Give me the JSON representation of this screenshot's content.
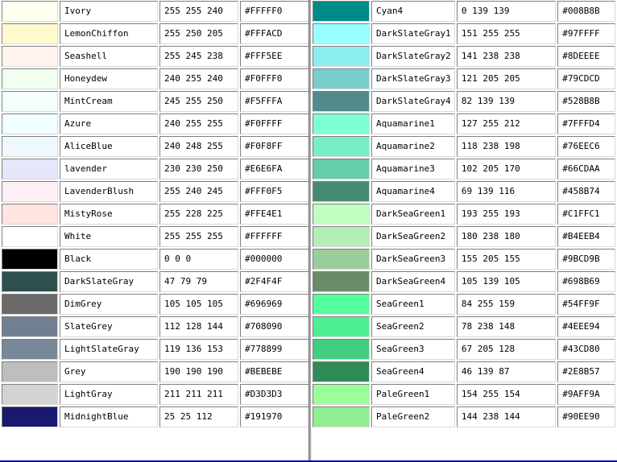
{
  "left_column": [
    {
      "name": "Ivory",
      "rgb": "255 255 240",
      "hex": "#FFFFF0",
      "color": "#FFFFF0"
    },
    {
      "name": "LemonChiffon",
      "rgb": "255 250 205",
      "hex": "#FFFACD",
      "color": "#FFFACD"
    },
    {
      "name": "Seashell",
      "rgb": "255 245 238",
      "hex": "#FFF5EE",
      "color": "#FFF5EE"
    },
    {
      "name": "Honeydew",
      "rgb": "240 255 240",
      "hex": "#F0FFF0",
      "color": "#F0FFF0"
    },
    {
      "name": "MintCream",
      "rgb": "245 255 250",
      "hex": "#F5FFFA",
      "color": "#F5FFFA"
    },
    {
      "name": "Azure",
      "rgb": "240 255 255",
      "hex": "#F0FFFF",
      "color": "#F0FFFF"
    },
    {
      "name": "AliceBlue",
      "rgb": "240 248 255",
      "hex": "#F0F8FF",
      "color": "#F0F8FF"
    },
    {
      "name": "lavender",
      "rgb": "230 230 250",
      "hex": "#E6E6FA",
      "color": "#E6E6FA"
    },
    {
      "name": "LavenderBlush",
      "rgb": "255 240 245",
      "hex": "#FFF0F5",
      "color": "#FFF0F5"
    },
    {
      "name": "MistyRose",
      "rgb": "255 228 225",
      "hex": "#FFE4E1",
      "color": "#FFE4E1"
    },
    {
      "name": "White",
      "rgb": "255 255 255",
      "hex": "#FFFFFF",
      "color": "#FFFFFF"
    },
    {
      "name": "Black",
      "rgb": "0 0 0",
      "hex": "#000000",
      "color": "#000000"
    },
    {
      "name": "DarkSlateGray",
      "rgb": "47 79 79",
      "hex": "#2F4F4F",
      "color": "#2F4F4F"
    },
    {
      "name": "DimGrey",
      "rgb": "105 105 105",
      "hex": "#696969",
      "color": "#696969"
    },
    {
      "name": "SlateGrey",
      "rgb": "112 128 144",
      "hex": "#708090",
      "color": "#708090"
    },
    {
      "name": "LightSlateGray",
      "rgb": "119 136 153",
      "hex": "#778899",
      "color": "#778899"
    },
    {
      "name": "Grey",
      "rgb": "190 190 190",
      "hex": "#BEBEBE",
      "color": "#BEBEBE"
    },
    {
      "name": "LightGray",
      "rgb": "211 211 211",
      "hex": "#D3D3D3",
      "color": "#D3D3D3"
    },
    {
      "name": "MidnightBlue",
      "rgb": "25 25 112",
      "hex": "#191970",
      "color": "#191970"
    }
  ],
  "right_column": [
    {
      "name": "Cyan4",
      "rgb": "0 139 139",
      "hex": "#008B8B",
      "color": "#008B8B"
    },
    {
      "name": "DarkSlateGray1",
      "rgb": "151 255 255",
      "hex": "#97FFFF",
      "color": "#97FFFF"
    },
    {
      "name": "DarkSlateGray2",
      "rgb": "141 238 238",
      "hex": "#8DEEEE",
      "color": "#8DEEEE"
    },
    {
      "name": "DarkSlateGray3",
      "rgb": "121 205 205",
      "hex": "#79CDCD",
      "color": "#79CDCD"
    },
    {
      "name": "DarkSlateGray4",
      "rgb": "82 139 139",
      "hex": "#528B8B",
      "color": "#528B8B"
    },
    {
      "name": "Aquamarine1",
      "rgb": "127 255 212",
      "hex": "#7FFFD4",
      "color": "#7FFFD4"
    },
    {
      "name": "Aquamarine2",
      "rgb": "118 238 198",
      "hex": "#76EEC6",
      "color": "#76EEC6"
    },
    {
      "name": "Aquamarine3",
      "rgb": "102 205 170",
      "hex": "#66CDAA",
      "color": "#66CDAA"
    },
    {
      "name": "Aquamarine4",
      "rgb": "69 139 116",
      "hex": "#458B74",
      "color": "#458B74"
    },
    {
      "name": "DarkSeaGreen1",
      "rgb": "193 255 193",
      "hex": "#C1FFC1",
      "color": "#C1FFC1"
    },
    {
      "name": "DarkSeaGreen2",
      "rgb": "180 238 180",
      "hex": "#B4EEB4",
      "color": "#B4EEB4"
    },
    {
      "name": "DarkSeaGreen3",
      "rgb": "155 205 155",
      "hex": "#9BCD9B",
      "color": "#9BCD9B"
    },
    {
      "name": "DarkSeaGreen4",
      "rgb": "105 139 105",
      "hex": "#698B69",
      "color": "#698B69"
    },
    {
      "name": "SeaGreen1",
      "rgb": "84 255 159",
      "hex": "#54FF9F",
      "color": "#54FF9F"
    },
    {
      "name": "SeaGreen2",
      "rgb": "78 238 148",
      "hex": "#4EEE94",
      "color": "#4EEE94"
    },
    {
      "name": "SeaGreen3",
      "rgb": "67 205 128",
      "hex": "#43CD80",
      "color": "#43CD80"
    },
    {
      "name": "SeaGreen4",
      "rgb": "46 139 87",
      "hex": "#2E8B57",
      "color": "#2E8B57"
    },
    {
      "name": "PaleGreen1",
      "rgb": "154 255 154",
      "hex": "#9AFF9A",
      "color": "#9AFF9A"
    },
    {
      "name": "PaleGreen2",
      "rgb": "144 238 144",
      "hex": "#90EE90",
      "color": "#90EE90"
    }
  ],
  "colors": {
    "page_background": "#FFFFFF",
    "divider": "#A8A8A8",
    "bottom_bar": "#10109A"
  }
}
